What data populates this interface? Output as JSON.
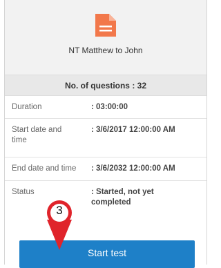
{
  "test": {
    "title": "NT Matthew to John",
    "questions_label": "No. of questions : 32"
  },
  "details": {
    "duration_label": "Duration",
    "duration_value": ": 03:00:00",
    "start_label_1": "Start date and",
    "start_label_2": "time",
    "start_value": ": 3/6/2017 12:00:00 AM",
    "end_label": "End date and time",
    "end_value": ": 3/6/2032 12:00:00 AM",
    "status_label": "Status",
    "status_value_1": ": Started, not yet",
    "status_value_2": "completed"
  },
  "actions": {
    "start_label": "Start test"
  },
  "annotation": {
    "step_number": "3",
    "color": "#e0242b"
  },
  "colors": {
    "icon": "#f2784b",
    "button": "#1e80c8"
  },
  "icons": [
    "document-icon"
  ]
}
